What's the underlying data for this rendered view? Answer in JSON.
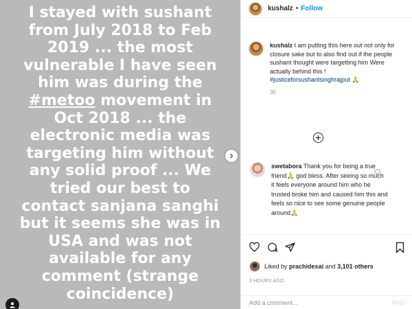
{
  "story": {
    "text_lines": [
      "I stayed with sushant",
      "from July 2018 to Feb",
      "2019 ... the most",
      "vulnerable I have seen",
      "him was during the",
      "",
      "Oct 2018 ... the",
      "electronic media was",
      "targeting him without",
      "any solid proof ... We",
      "tried our best to",
      "contact sanjana sanghi",
      "but it seems she was in",
      "USA and was not",
      "available for any",
      "comment (strange",
      "coincidence)"
    ],
    "metoo_tag": "#metoo",
    "metoo_rest": " movement in"
  },
  "post": {
    "username": "kushalz",
    "dot": "•",
    "follow_label": "Follow",
    "caption": {
      "username": "kushalz",
      "text": "I am putting this here out not only for closure sake but to also find out if the people sushant thought were targetting him Were actually behind this !",
      "hashtag": "#justiceforsushantsinghrajput",
      "emoji": "🙏",
      "time": "3h"
    },
    "comment": {
      "username": "swetabora",
      "text": "Thank you for being a true friend🙏 god bless. After seeing so much it feels everyone around him who he trusted broke him and caused him this and feels so nice to see some genuine people around🙏"
    },
    "likes": {
      "prefix": "Liked by",
      "user": "prachidesai",
      "middle": "and",
      "count": "3,101 others"
    },
    "time_ago": "3 HOURS AGO",
    "add_comment_placeholder": "Add a comment...",
    "post_label": "Post"
  },
  "icons": {
    "heart": "heart-icon",
    "comment": "comment-icon",
    "share": "share-icon",
    "save": "bookmark-icon",
    "more_replies": "plus-circle-icon",
    "next": "chevron-right-icon",
    "tagged": "user-tag-icon"
  },
  "colors": {
    "story_bg": "#b9b9b9",
    "link_blue": "#0095f6",
    "hashtag": "#00376b",
    "muted": "#8e8e8e"
  }
}
